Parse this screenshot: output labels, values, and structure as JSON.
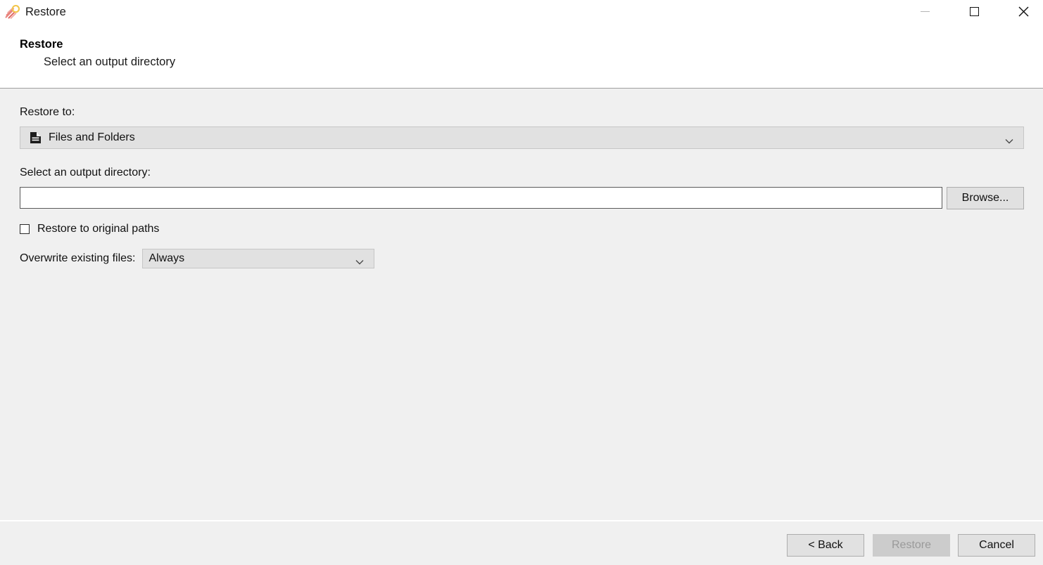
{
  "window": {
    "title": "Restore",
    "icon": "duplicati-comet-icon",
    "controls": {
      "minimize": "minimize-icon",
      "maximize": "maximize-icon",
      "close": "close-icon"
    }
  },
  "header": {
    "title": "Restore",
    "subtitle": "Select an output directory"
  },
  "form": {
    "restore_to_label": "Restore to:",
    "restore_to_value": "Files and Folders",
    "restore_to_icon": "file-document-icon",
    "output_dir_label": "Select an output directory:",
    "output_dir_value": "",
    "output_dir_placeholder": "",
    "browse_label": "Browse...",
    "original_paths_label": "Restore to original paths",
    "original_paths_checked": false,
    "overwrite_label": "Overwrite existing files:",
    "overwrite_value": "Always"
  },
  "footer": {
    "back_label": "< Back",
    "restore_label": "Restore",
    "restore_enabled": false,
    "cancel_label": "Cancel"
  },
  "colors": {
    "window_background": "#f0f0f0",
    "header_background": "#ffffff",
    "control_fill": "#e1e1e1",
    "control_border": "#adadad",
    "input_background": "#ffffff",
    "input_border": "#5a5a5a",
    "disabled_fill": "#cccccc",
    "disabled_text": "#9a9a9a",
    "separator": "#9e9e9e",
    "text": "#111111"
  }
}
